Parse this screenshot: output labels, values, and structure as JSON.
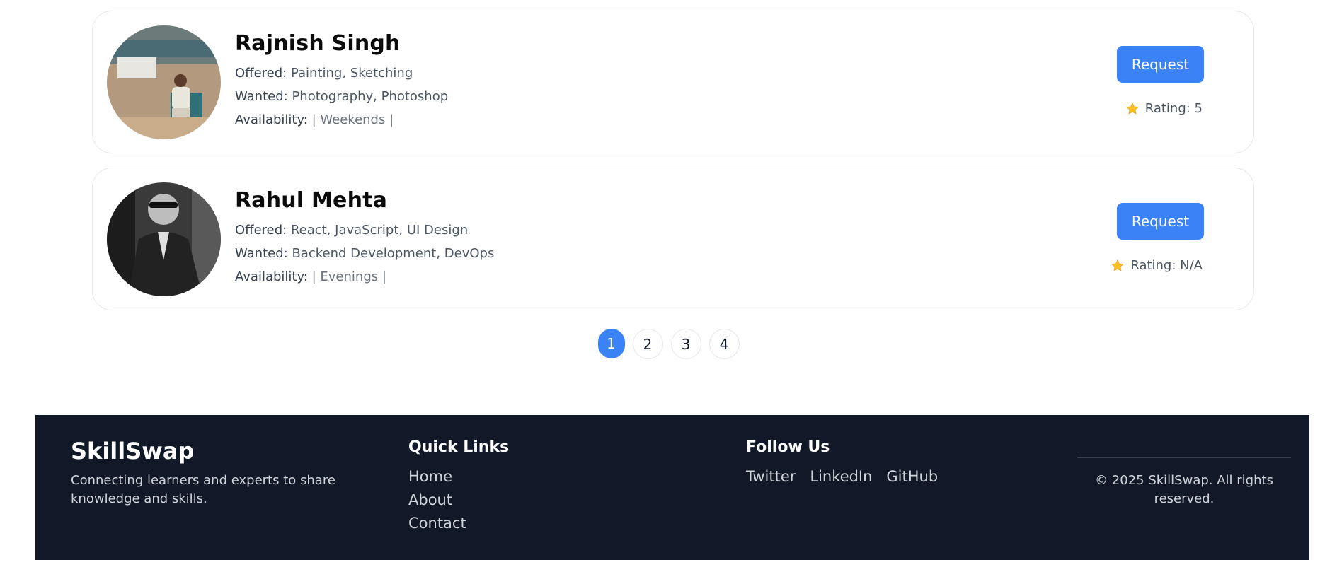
{
  "users": [
    {
      "name": "Rajnish Singh",
      "offered_label": "Offered:",
      "offered": "Painting, Sketching",
      "wanted_label": "Wanted:",
      "wanted": "Photography, Photoshop",
      "availability_label": "Availability:",
      "availability": "| Weekends |",
      "request_label": "Request",
      "rating": "Rating: 5"
    },
    {
      "name": "Rahul Mehta",
      "offered_label": "Offered:",
      "offered": "React, JavaScript, UI Design",
      "wanted_label": "Wanted:",
      "wanted": "Backend Development, DevOps",
      "availability_label": "Availability:",
      "availability": "| Evenings |",
      "request_label": "Request",
      "rating": "Rating: N/A"
    }
  ],
  "pagination": {
    "pages": [
      "1",
      "2",
      "3",
      "4"
    ],
    "current": "1"
  },
  "footer": {
    "brand": "SkillSwap",
    "tagline": "Connecting learners and experts to share knowledge and skills.",
    "quick_links_title": "Quick Links",
    "quick_links": [
      "Home",
      "About",
      "Contact"
    ],
    "follow_title": "Follow Us",
    "social": [
      "Twitter",
      "LinkedIn",
      "GitHub"
    ],
    "copyright": "© 2025 SkillSwap. All rights reserved."
  },
  "colors": {
    "accent": "#3b82f6",
    "footer_bg": "#111827",
    "star": "#fbbf24"
  },
  "icons": {
    "rating": "star-icon"
  }
}
